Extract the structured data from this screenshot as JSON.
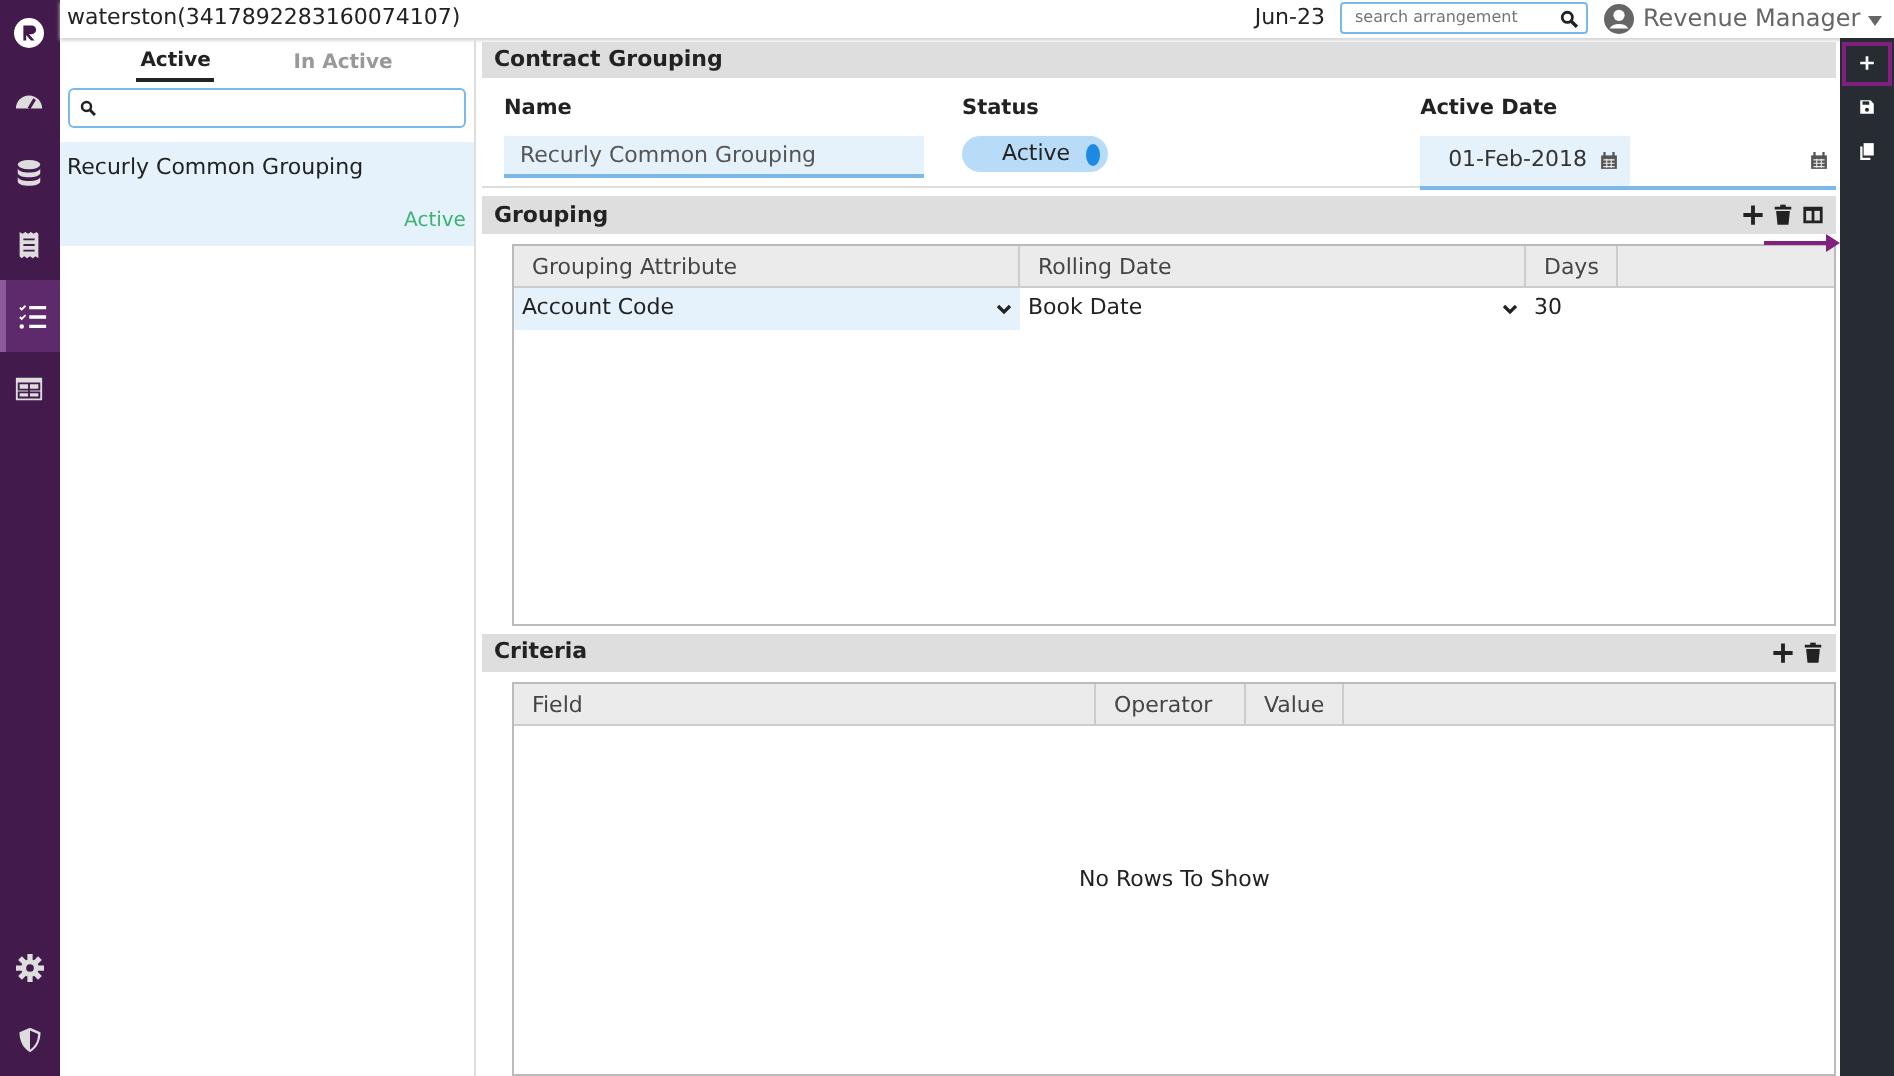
{
  "nav": [
    {
      "kind": "logo",
      "selected": false
    },
    {
      "kind": "gauge",
      "selected": false
    },
    {
      "kind": "database",
      "selected": false
    },
    {
      "kind": "receipt",
      "selected": false
    },
    {
      "kind": "checklist",
      "selected": true
    },
    {
      "kind": "table",
      "selected": false
    }
  ],
  "nav_bottom": [
    {
      "kind": "gear"
    },
    {
      "kind": "shield"
    }
  ],
  "header": {
    "title": "waterston(3417892283160074107)",
    "period": "Jun-23",
    "search": {
      "placeholder": "search arrangement"
    },
    "user": "Revenue Manager"
  },
  "list_panel": {
    "tabs": [
      {
        "label": "Active",
        "selected": true
      },
      {
        "label": "In Active",
        "selected": false
      }
    ],
    "items": [
      {
        "name": "Recurly Common Grouping",
        "status": "Active",
        "selected": true
      }
    ]
  },
  "contract_grouping": {
    "title": "Contract Grouping",
    "name_label": "Name",
    "name_value": "Recurly Common Grouping",
    "status_label": "Status",
    "status_value": "Active",
    "status_on": true,
    "date_label": "Active Date",
    "date_value": "01-Feb-2018"
  },
  "grouping": {
    "title": "Grouping",
    "columns": [
      "Grouping Attribute",
      "Rolling Date",
      "Days"
    ],
    "rows": [
      [
        "Account Code",
        "Book Date",
        "30"
      ]
    ]
  },
  "criteria": {
    "title": "Criteria",
    "columns": [
      "Field",
      "Operator",
      "Value"
    ],
    "empty_text": "No Rows To Show"
  },
  "toolbar": [
    {
      "kind": "plus",
      "highlighted": true
    },
    {
      "kind": "save",
      "highlighted": false
    },
    {
      "kind": "copy",
      "highlighted": false
    }
  ]
}
